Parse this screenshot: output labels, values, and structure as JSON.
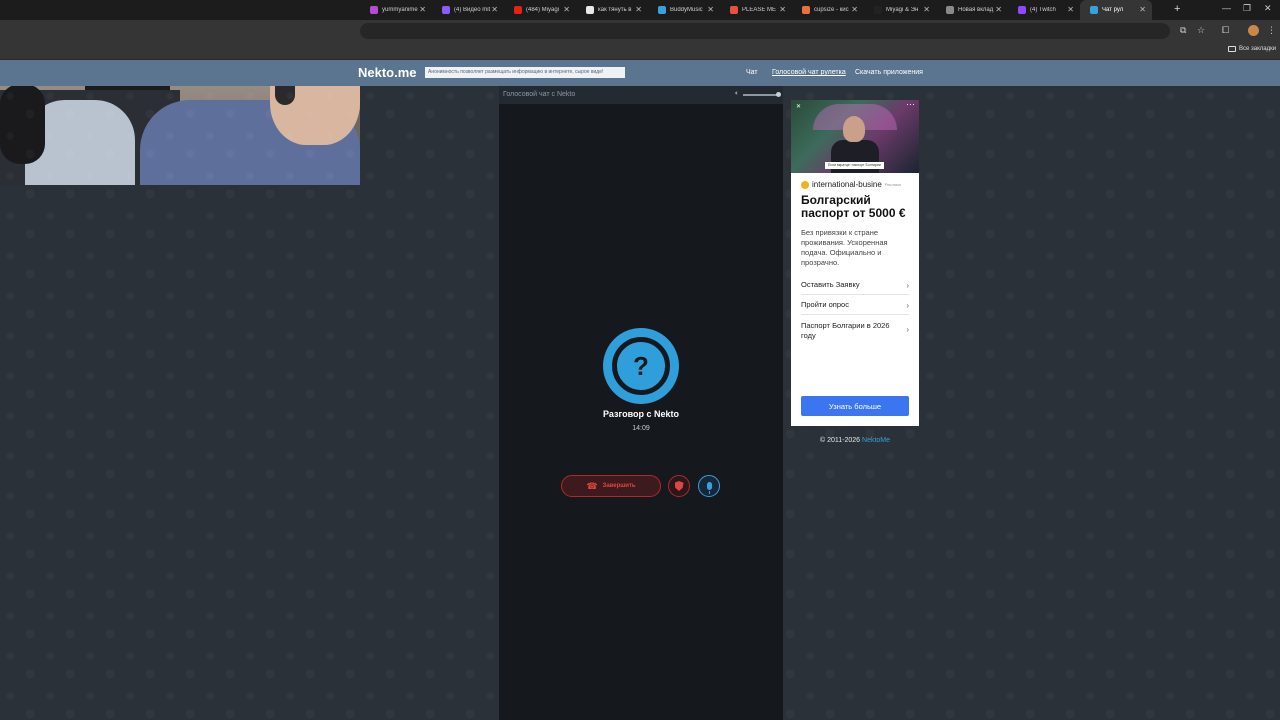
{
  "browser": {
    "tabs": [
      {
        "title": "yummyanime",
        "color": "#b84bd6"
      },
      {
        "title": "(4) Видео mit",
        "color": "#8b5cf6"
      },
      {
        "title": "(484) Miyagi",
        "color": "#e62117"
      },
      {
        "title": "как тянуть в",
        "color": "#e8e8e8"
      },
      {
        "title": "BuddyMusic",
        "color": "#3aa0dc"
      },
      {
        "title": "PLEASE ME",
        "color": "#e5533b"
      },
      {
        "title": "cupsize - кис",
        "color": "#e5733b"
      },
      {
        "title": "Miyagi & Эн",
        "color": "#222222"
      },
      {
        "title": "Новая вклад",
        "color": "#8a8a8a"
      },
      {
        "title": "(4) Twitch",
        "color": "#9146ff"
      },
      {
        "title": "Чат рул",
        "color": "#3aa0dc",
        "active": true
      }
    ],
    "bookmarks_all": "Все закладки"
  },
  "site": {
    "logo": "Nekto.me",
    "notice": "Анонимность позволяет размещать информацию в интернете, сырое виде!",
    "nav": {
      "chat": "Чат",
      "voice": "Голосовой чат рулетка",
      "apps": "Скачать приложения"
    }
  },
  "chat": {
    "title": "Голосовой чат с Nekto",
    "avatar_glyph": "?",
    "partner": "Разговор с Nekto",
    "time": "14:09",
    "end_label": "Завершить",
    "volume_level": 1.0
  },
  "ad": {
    "image_caption": "Если вкратце: паспорт Болгарии",
    "source": "international-busine",
    "source_tag": "Реклама",
    "title": "Болгарский паспорт от 5000 €",
    "desc": "Без привязки к стране проживания. Ускоренная подача. Официально и прозрачно.",
    "links": [
      "Оставить Заявку",
      "Пройти опрос",
      "Паспорт Болгарии в 2026 году"
    ],
    "cta": "Узнать больше"
  },
  "footer": {
    "copyright": "© 2011-2026",
    "brand": "NektoMe"
  }
}
